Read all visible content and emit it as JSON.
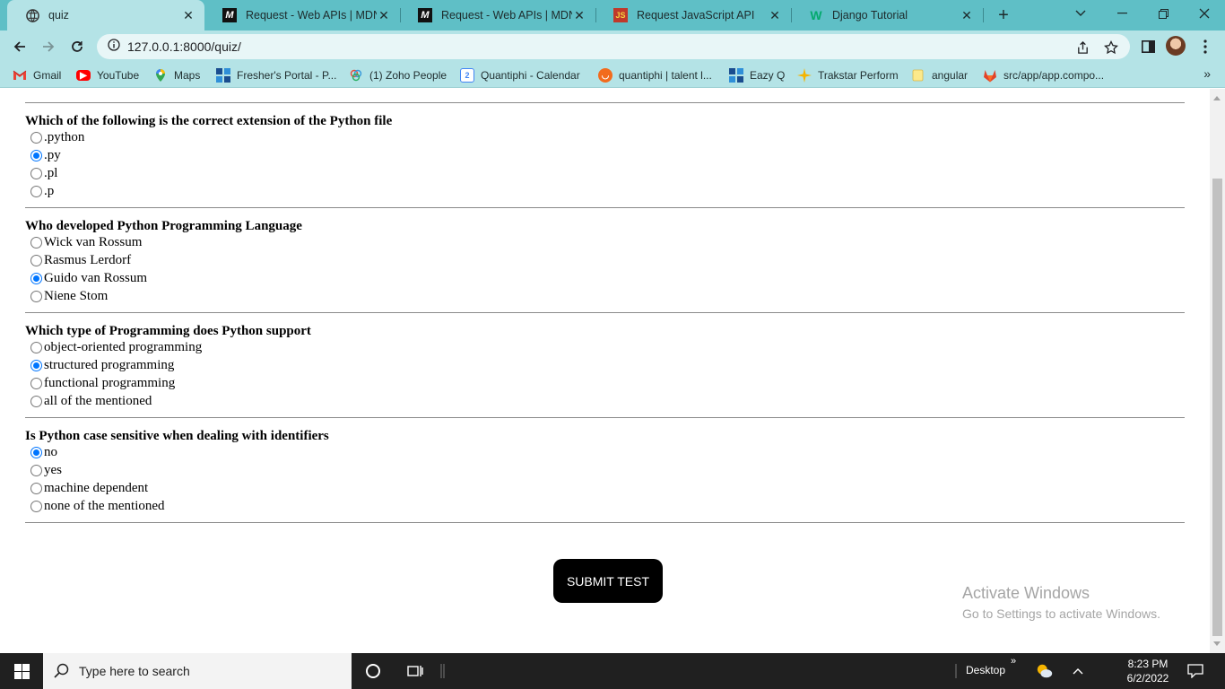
{
  "browser": {
    "tabs": [
      {
        "title": "quiz",
        "icon": "globe-icon"
      },
      {
        "title": "Request - Web APIs | MDN",
        "icon": "mdn-icon"
      },
      {
        "title": "Request - Web APIs | MDN",
        "icon": "mdn-icon"
      },
      {
        "title": "Request JavaScript API",
        "icon": "js-icon"
      },
      {
        "title": "Django Tutorial",
        "icon": "w3schools-icon"
      }
    ],
    "url": "127.0.0.1:8000/quiz/",
    "bookmarks": [
      {
        "label": "Gmail"
      },
      {
        "label": "YouTube"
      },
      {
        "label": "Maps"
      },
      {
        "label": "Fresher's Portal - P..."
      },
      {
        "label": "(1) Zoho People"
      },
      {
        "label": "Quantiphi - Calendar"
      },
      {
        "label": "quantiphi | talent l..."
      },
      {
        "label": "Eazy Q"
      },
      {
        "label": "Trakstar Perform"
      },
      {
        "label": "angular"
      },
      {
        "label": "src/app/app.compo..."
      }
    ]
  },
  "quiz": {
    "questions": [
      {
        "text": "Which of the following is the correct extension of the Python file",
        "options": [
          {
            "label": ".python",
            "checked": false
          },
          {
            "label": ".py",
            "checked": true
          },
          {
            "label": ".pl",
            "checked": false
          },
          {
            "label": ".p",
            "checked": false
          }
        ]
      },
      {
        "text": "Who developed Python Programming Language",
        "options": [
          {
            "label": "Wick van Rossum",
            "checked": false
          },
          {
            "label": "Rasmus Lerdorf",
            "checked": false
          },
          {
            "label": "Guido van Rossum",
            "checked": true
          },
          {
            "label": "Niene Stom",
            "checked": false
          }
        ]
      },
      {
        "text": "Which type of Programming does Python support",
        "options": [
          {
            "label": "object-oriented programming",
            "checked": false
          },
          {
            "label": "structured programming",
            "checked": true
          },
          {
            "label": "functional programming",
            "checked": false
          },
          {
            "label": "all of the mentioned",
            "checked": false
          }
        ]
      },
      {
        "text": "Is Python case sensitive when dealing with identifiers",
        "options": [
          {
            "label": "no",
            "checked": true
          },
          {
            "label": "yes",
            "checked": false
          },
          {
            "label": "machine dependent",
            "checked": false
          },
          {
            "label": "none of the mentioned",
            "checked": false
          }
        ]
      }
    ],
    "submit_label": "SUBMIT TEST"
  },
  "watermark": {
    "line1": "Activate Windows",
    "line2": "Go to Settings to activate Windows."
  },
  "taskbar": {
    "search_placeholder": "Type here to search",
    "desktop_label": "Desktop",
    "time": "8:23 PM",
    "date": "6/2/2022"
  }
}
